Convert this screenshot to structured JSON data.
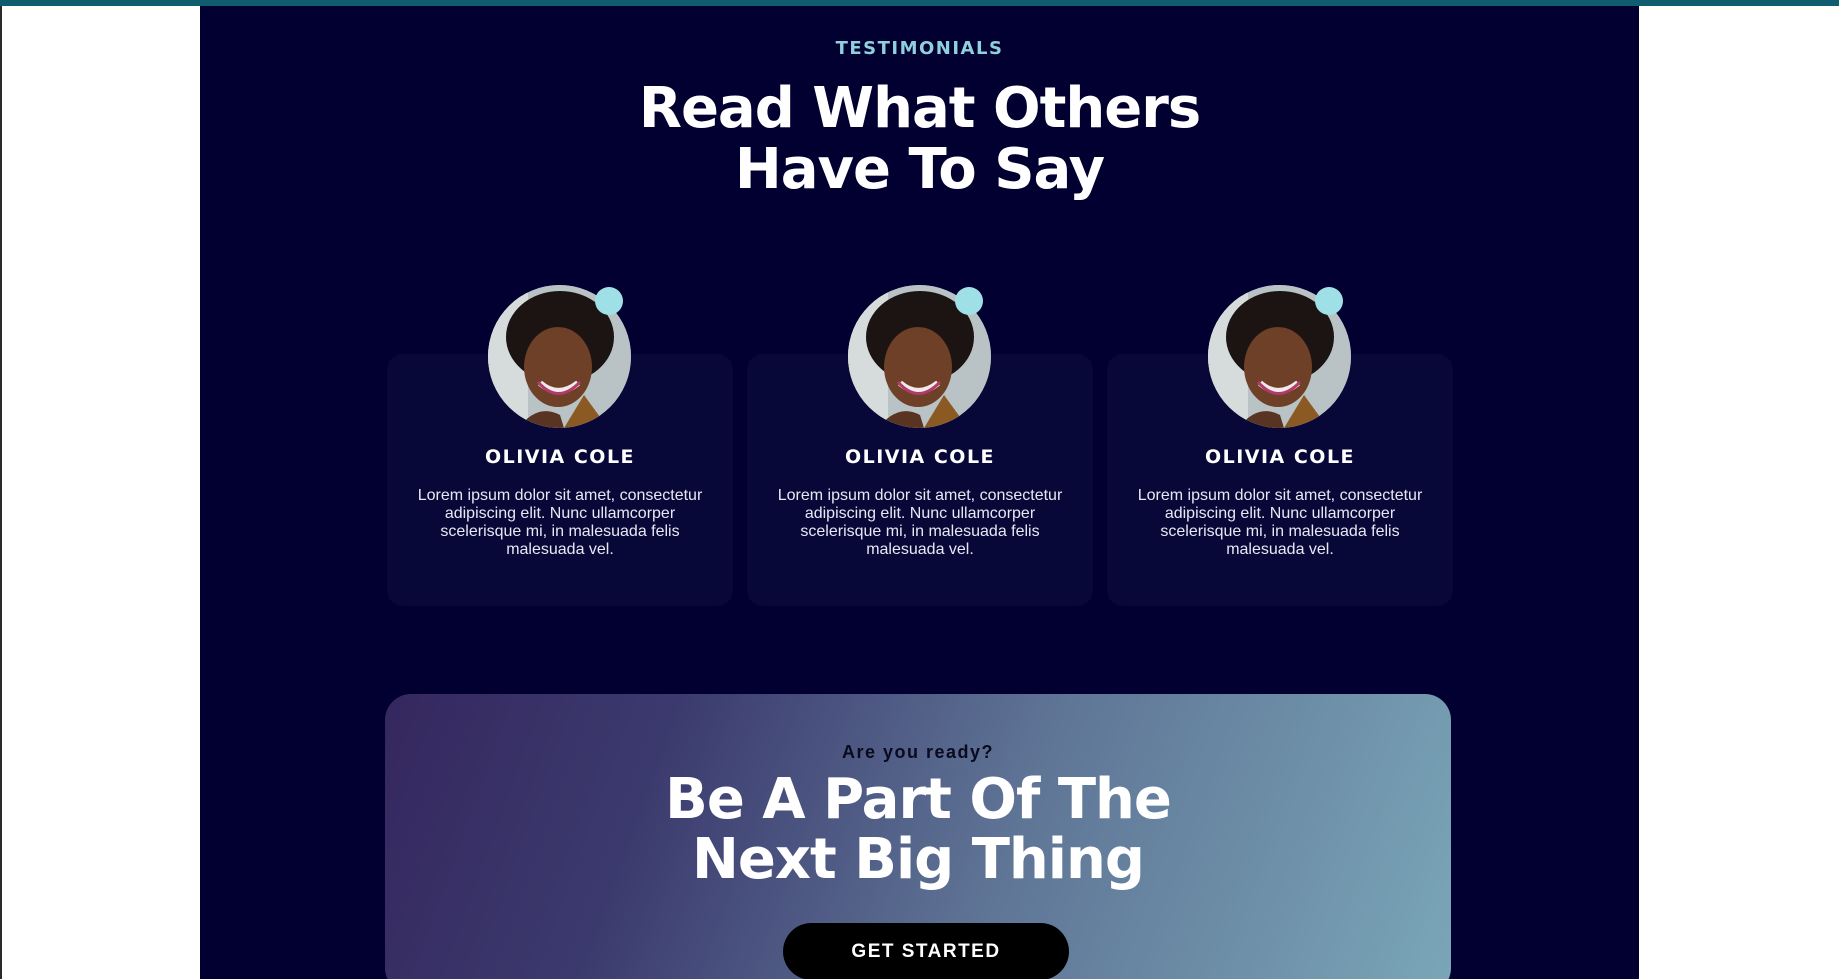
{
  "testimonials": {
    "eyebrow": "TESTIMONIALS",
    "heading_line1": "Read What Others",
    "heading_line2": "Have To Say",
    "cards": [
      {
        "name": "OLIVIA COLE",
        "text": "Lorem ipsum dolor sit amet, consectetur adipiscing elit. Nunc ullamcorper scelerisque mi, in malesuada felis malesuada vel.",
        "avatar_icon": "person-photo-avatar"
      },
      {
        "name": "OLIVIA COLE",
        "text": "Lorem ipsum dolor sit amet, consectetur adipiscing elit. Nunc ullamcorper scelerisque mi, in malesuada felis malesuada vel.",
        "avatar_icon": "person-photo-avatar"
      },
      {
        "name": "OLIVIA COLE",
        "text": "Lorem ipsum dolor sit amet, consectetur adipiscing elit. Nunc ullamcorper scelerisque mi, in malesuada felis malesuada vel.",
        "avatar_icon": "person-photo-avatar"
      }
    ]
  },
  "cta": {
    "eyebrow": "Are you ready?",
    "heading_line1": "Be A Part Of The",
    "heading_line2": "Next Big Thing",
    "button_label": "GET STARTED"
  },
  "colors": {
    "page_background": "#010030",
    "card_background": "#080838",
    "accent": "#8fd0dc",
    "top_bar": "#0f5d6f"
  }
}
